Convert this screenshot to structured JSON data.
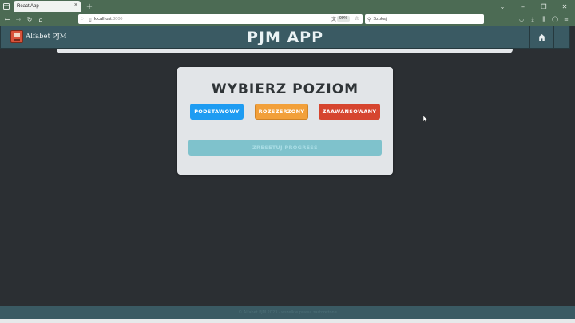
{
  "browser": {
    "tab_title": "React App",
    "tab_close": "×",
    "new_tab": "+",
    "url_host": "localhost",
    "url_port": ":3000",
    "zoom": "90%",
    "search_placeholder": "Szukaj"
  },
  "app": {
    "brand": "Alfabet PJM",
    "title": "PJM APP"
  },
  "card": {
    "title": "WYBIERZ POZIOM",
    "levels": [
      {
        "label": "PODSTAWOWY",
        "color": "#1e9cf2"
      },
      {
        "label": "ROZSZERZONY",
        "color": "#f2a03a"
      },
      {
        "label": "ZAAWANSOWANY",
        "color": "#d6452f"
      }
    ],
    "reset_label": "ZRESETUJ PROGRESS"
  },
  "footer": {
    "text": "© Alfabet PJM 2023 · wszelkie prawa zastrzeżone"
  },
  "colors": {
    "background": "#2b2f33",
    "header": "#3a5a63",
    "browser_chrome": "#4c6b54",
    "reset": "#7fc2cc"
  }
}
